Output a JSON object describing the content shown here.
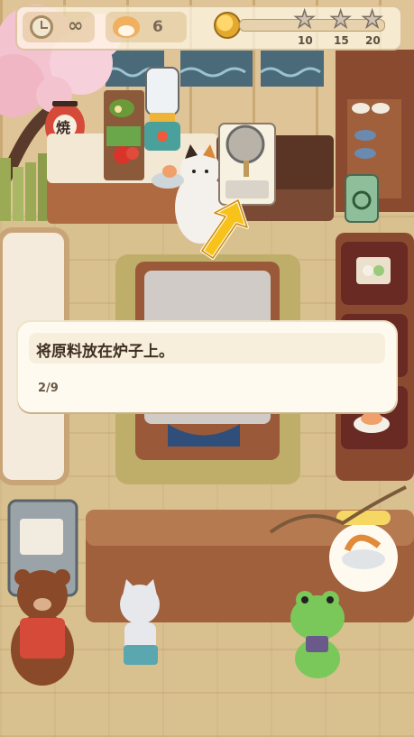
{
  "hud": {
    "time_value": "∞",
    "cat_count": "6",
    "coin_progress": 0.0,
    "star_thresholds": [
      "10",
      "15",
      "20"
    ],
    "icons": [
      "clock-icon",
      "cat-face-icon",
      "coin-icon",
      "star-icon"
    ]
  },
  "scene": {
    "lantern_char": "焼",
    "recycle_icon": "recycle-icon"
  },
  "tutorial": {
    "message": "将原料放在炉子上。",
    "step": "2/9"
  },
  "colors": {
    "accent_arrow": "#f7c21a",
    "bubble_bg": "#fffaf0",
    "text_dark": "#3f3024"
  }
}
